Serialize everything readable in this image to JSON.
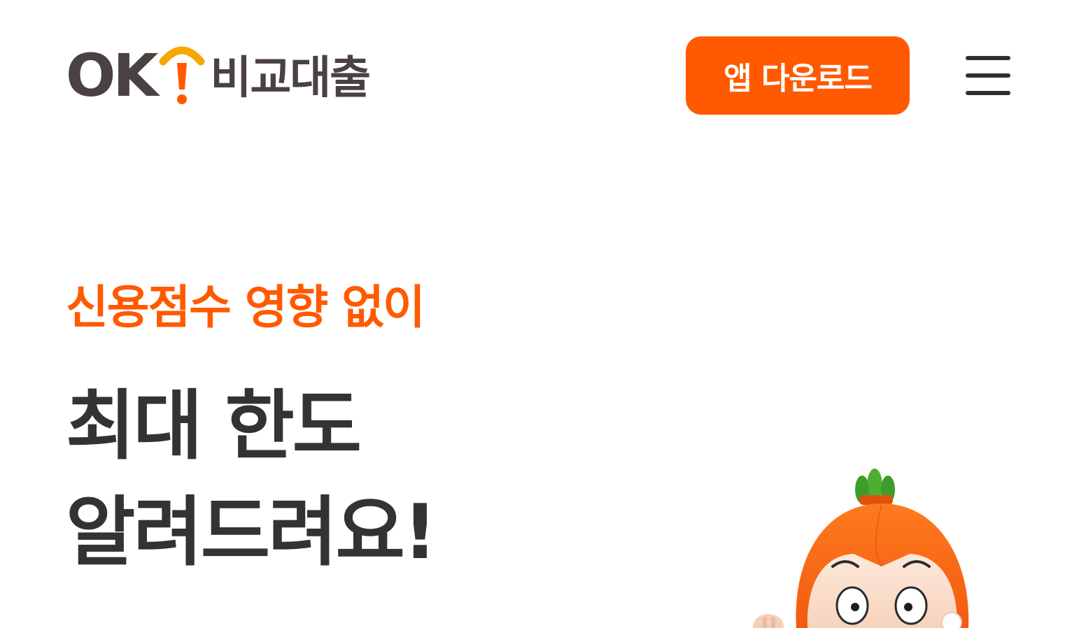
{
  "header": {
    "logo": {
      "latin": "OK",
      "korean": "비교대출",
      "mark_icon": "exclamation-wifi-mark"
    },
    "download_button_label": "앱 다운로드",
    "menu_icon": "hamburger-menu-icon"
  },
  "hero": {
    "subtitle": "신용점수 영향 없이",
    "title_line1": "최대 한도",
    "title_line2": "알려드려요!",
    "mascot": "carrot-character-mascot"
  },
  "colors": {
    "brand_orange": "#ff5a00",
    "logo_brown": "#4a4142",
    "mark_yellow": "#f5a800",
    "text_dark": "#333333",
    "background": "#ffffff"
  }
}
